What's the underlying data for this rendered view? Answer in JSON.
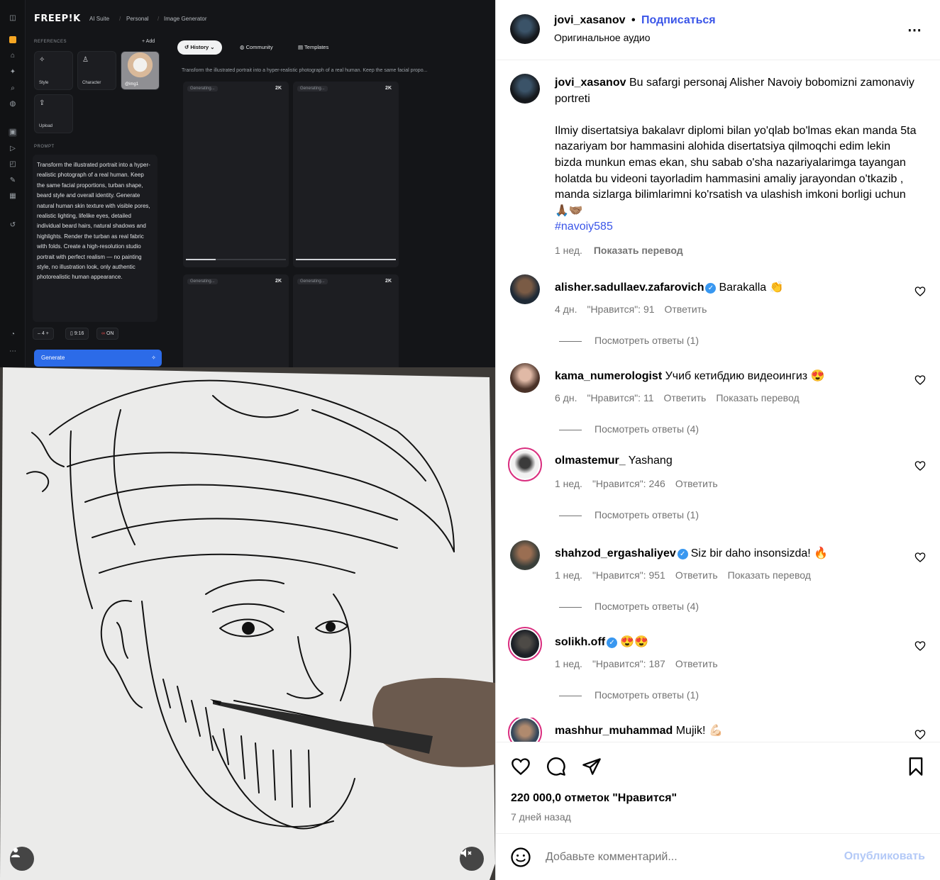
{
  "video": {
    "app": {
      "logo": "FREEP!K",
      "breadcrumb": [
        "AI Suite",
        "Personal",
        "Image Generator"
      ],
      "references_label": "REFERENCES",
      "add_label": "Add",
      "ref_cards": [
        "Style",
        "Character",
        "Upload"
      ],
      "portrait_label": "@img1",
      "prompt_label": "PROMPT",
      "prompt_text": "Transform the illustrated portrait into a hyper-realistic photograph of a real human. Keep the same facial proportions, turban shape, beard style and overall identity. Generate natural human skin texture with visible pores, realistic lighting, lifelike eyes, detailed individual beard hairs, natural shadows and highlights. Render the turban as real fabric with folds. Create a high-resolution studio portrait with perfect realism — no painting style, no illustration look, only authentic photorealistic human appearance.",
      "count": "4",
      "ratio": "9:16",
      "toggle": "ON",
      "generate_label": "Generate",
      "tabs": [
        "History",
        "Community",
        "Templates"
      ],
      "prompt_preview": "Transform the illustrated portrait into a hyper-realistic photograph of a real human. Keep the same facial propo...",
      "card_status": "Generating...",
      "card_res": "2K"
    }
  },
  "post": {
    "author": "jovi_xasanov",
    "follow_label": "Подписаться",
    "audio": "Оригинальное аудио",
    "caption_p1": "Bu safargi personaj Alisher Navoiy bobomizni zamonaviy portreti",
    "caption_p2": "Ilmiy disertatsiya bakalavr diplomi bilan yo'qlab bo'lmas ekan manda 5ta nazariyam bor hammasini alohida disertatsiya qilmoqchi edim lekin bizda munkun emas ekan, shu sabab o'sha nazariyalarimga tayangan holatda bu videoni tayorladim hammasini amaliy jarayondan o'tkazib , manda sizlarga bilimlarimni ko'rsatish va ulashish imkoni borligi uchun🙏🏾🤝🏽",
    "hashtag": "#navoiy585",
    "caption_time": "1 нед.",
    "translate_label": "Показать перевод",
    "likes": "220 000,0 отметок \"Нравится\"",
    "posted": "7 дней назад",
    "comment_placeholder": "Добавьте комментарий...",
    "publish_label": "Опубликовать"
  },
  "comments": [
    {
      "user": "alisher.sadullaev.zafarovich",
      "verified": true,
      "text": "Barakalla 👏",
      "time": "4 дн.",
      "likes": "\"Нравится\": 91",
      "reply": "Ответить",
      "translate": "",
      "replies": "Посмотреть ответы (1)"
    },
    {
      "user": "kama_numerologist",
      "verified": false,
      "text": "Учиб кетибдию видеоингиз 😍",
      "time": "6 дн.",
      "likes": "\"Нравится\": 11",
      "reply": "Ответить",
      "translate": "Показать перевод",
      "replies": "Посмотреть ответы (4)"
    },
    {
      "user": "olmastemur_",
      "verified": false,
      "text": "Yashang",
      "time": "1 нед.",
      "likes": "\"Нравится\": 246",
      "reply": "Ответить",
      "translate": "",
      "replies": "Посмотреть ответы (1)"
    },
    {
      "user": "shahzod_ergashaliyev",
      "verified": true,
      "text": "Siz bir daho insonsizda! 🔥",
      "time": "1 нед.",
      "likes": "\"Нравится\": 951",
      "reply": "Ответить",
      "translate": "Показать перевод",
      "replies": "Посмотреть ответы (4)"
    },
    {
      "user": "solikh.off",
      "verified": true,
      "text": "😍😍",
      "time": "1 нед.",
      "likes": "\"Нравится\": 187",
      "reply": "Ответить",
      "translate": "",
      "replies": "Посмотреть ответы (1)"
    },
    {
      "user": "mashhur_muhammad",
      "verified": false,
      "text": "Mujik! 💪🏻",
      "time": "",
      "likes": "",
      "reply": "",
      "translate": "",
      "replies": ""
    }
  ],
  "colors": {
    "accent": "#3a55e8",
    "muted": "#737373",
    "verified": "#3897f0",
    "freepik_button": "#2c6be8"
  }
}
